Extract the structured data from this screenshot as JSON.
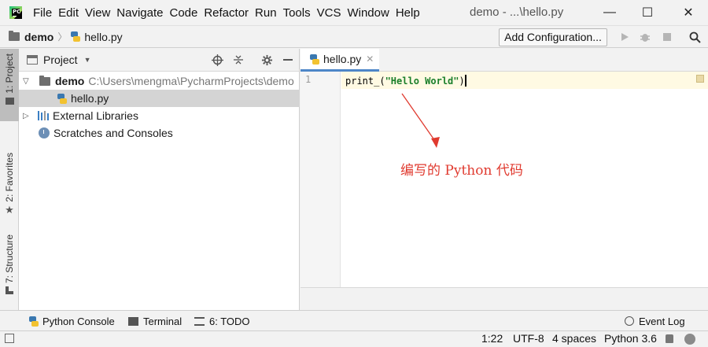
{
  "menu": [
    "File",
    "Edit",
    "View",
    "Navigate",
    "Code",
    "Refactor",
    "Run",
    "Tools",
    "VCS",
    "Window",
    "Help"
  ],
  "window_title": "demo - ...\\hello.py",
  "window_controls": {
    "minimize": "—",
    "maximize": "☐",
    "close": "✕"
  },
  "breadcrumb": {
    "project": "demo",
    "file": "hello.py"
  },
  "navbar": {
    "add_configuration": "Add Configuration..."
  },
  "left_strip": {
    "project": "1: Project",
    "favorites": "2: Favorites",
    "structure": "7: Structure"
  },
  "project_panel": {
    "title": "Project",
    "tree": {
      "root_name": "demo",
      "root_path": "C:\\Users\\mengma\\PycharmProjects\\demo",
      "file": "hello.py",
      "external_libraries": "External Libraries",
      "scratches": "Scratches and Consoles"
    }
  },
  "editor": {
    "tab": "hello.py",
    "line_number": "1",
    "code": {
      "func": "print_(",
      "string": "\"Hello World\"",
      "close": ")"
    },
    "annotation": "编写的 Python 代码"
  },
  "bottom_tools": {
    "python_console": "Python Console",
    "terminal": "Terminal",
    "todo": "6: TODO",
    "event_log": "Event Log"
  },
  "status": {
    "position": "1:22",
    "encoding": "UTF-8",
    "indent": "4 spaces",
    "interpreter": "Python 3.6"
  },
  "colors": {
    "accent": "#4d86c8",
    "annotation": "#e03a2f",
    "string": "#1a7f2a",
    "current_line": "#fffae3"
  }
}
